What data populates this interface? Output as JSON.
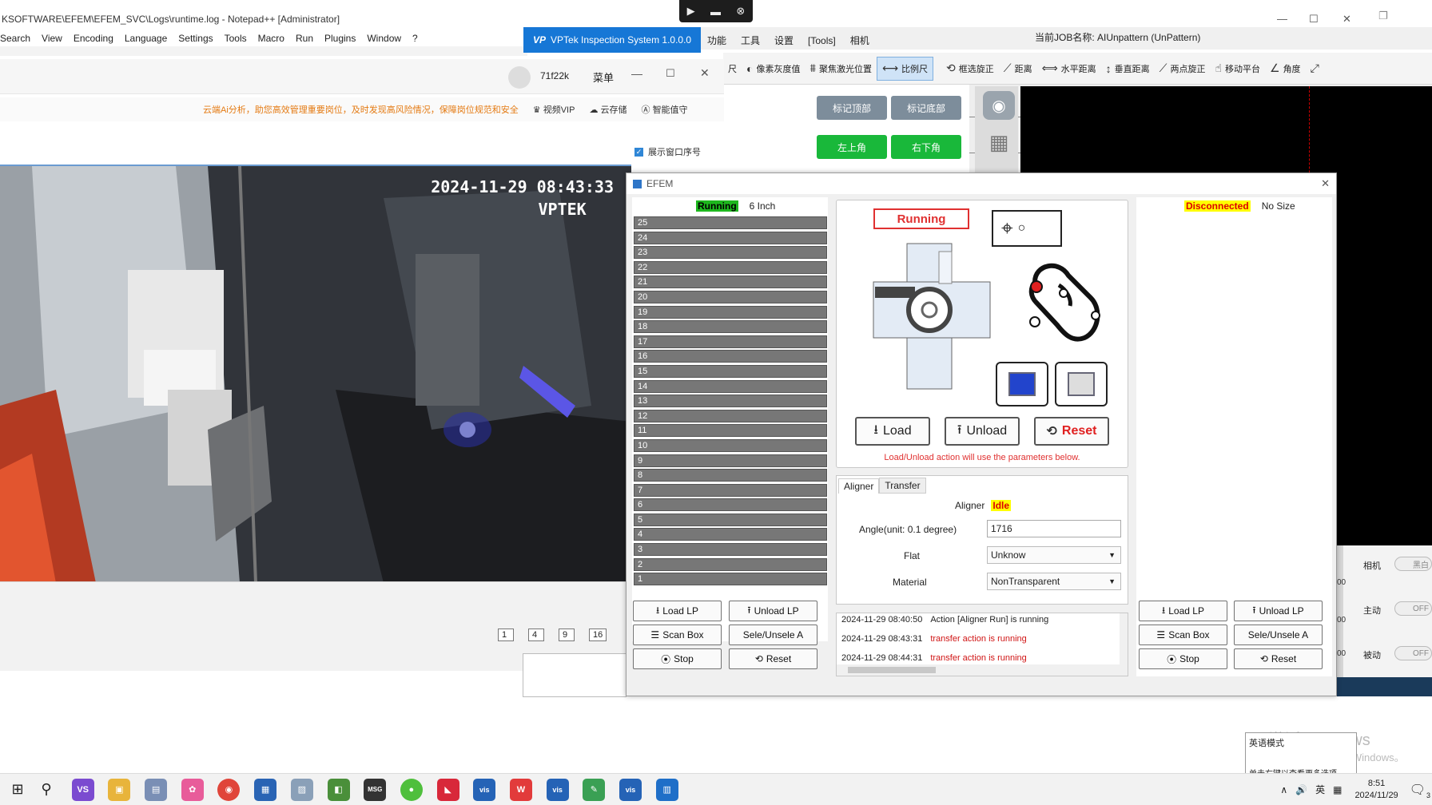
{
  "notepad": {
    "title": "KSOFTWARE\\EFEM\\EFEM_SVC\\Logs\\runtime.log - Notepad++ [Administrator]",
    "menu": [
      "Search",
      "View",
      "Encoding",
      "Language",
      "Settings",
      "Tools",
      "Macro",
      "Run",
      "Plugins",
      "Window",
      "?"
    ]
  },
  "vptek": {
    "app_title": "VPTek Inspection System 1.0.0.0",
    "menu": [
      "功能",
      "工具",
      "设置",
      "[Tools]",
      "相机"
    ],
    "job_label": "当前JOB名称: AIUnpattern (UnPattern)",
    "toolbar": [
      {
        "label": "尺",
        "icon": "ruler-icon"
      },
      {
        "label": "像素灰度值",
        "icon": "grayscale-icon"
      },
      {
        "label": "聚焦激光位置",
        "icon": "laser-focus-icon"
      },
      {
        "label": "比例尺",
        "icon": "scale-bar-icon",
        "active": true
      },
      {
        "label": "框选旋正",
        "icon": "box-rotate-icon"
      },
      {
        "label": "距离",
        "icon": "distance-icon"
      },
      {
        "label": "水平距离",
        "icon": "horizontal-distance-icon"
      },
      {
        "label": "垂直距离",
        "icon": "vertical-distance-icon"
      },
      {
        "label": "两点旋正",
        "icon": "two-point-rotate-icon"
      },
      {
        "label": "移动平台",
        "icon": "move-stage-icon"
      },
      {
        "label": "角度",
        "icon": "angle-icon"
      }
    ],
    "mark_top": "标记顶部",
    "mark_bottom": "标记底部",
    "top_left": "左上角",
    "bottom_right": "右下角",
    "right_labels": [
      {
        "label": "相机",
        "toggle": "黑白"
      },
      {
        "label": "主动",
        "toggle": "OFF"
      },
      {
        "label": "被动",
        "toggle": "OFF"
      }
    ],
    "side_values": [
      "00",
      "00",
      "00"
    ]
  },
  "video_window": {
    "user": "71f22k",
    "menu_label": "菜单",
    "tip": "云端Ai分析，助您高效管理重要岗位，及时发现高风险情况，保障岗位规范和安全",
    "tools": [
      "视频VIP",
      "云存储",
      "智能值守"
    ],
    "show_index_label": "展示窗口序号",
    "timestamp": "2024-11-29 08:43:33",
    "watermark": "VPTEK",
    "layouts": [
      "1",
      "4",
      "9",
      "16"
    ]
  },
  "efem": {
    "title": "EFEM",
    "left_port": {
      "status": "Running",
      "size": "6 Inch",
      "slots": [
        "25",
        "24",
        "23",
        "22",
        "21",
        "20",
        "19",
        "18",
        "17",
        "16",
        "15",
        "14",
        "13",
        "12",
        "11",
        "10",
        "9",
        "8",
        "7",
        "6",
        "5",
        "4",
        "3",
        "2",
        "1"
      ],
      "buttons": {
        "load_lp": "Load LP",
        "unload_lp": "Unload LP",
        "scan_box": "Scan Box",
        "sele": "Sele/Unsele A",
        "stop": "Stop",
        "reset": "Reset"
      }
    },
    "center": {
      "status": "Running",
      "load": "Load",
      "unload": "Unload",
      "reset": "Reset",
      "note": "Load/Unload action will use the parameters below.",
      "tabs": [
        "Aligner",
        "Transfer"
      ],
      "aligner_label": "Aligner",
      "aligner_status": "Idle",
      "angle_label": "Angle(unit:  0.1 degree)",
      "angle_value": "1716",
      "flat_label": "Flat",
      "flat_value": "Unknow",
      "material_label": "Material",
      "material_value": "NonTransparent",
      "log": [
        {
          "time": "2024-11-29 08:40:50",
          "msg": "Action [Aligner Run] is running",
          "color": "#222222"
        },
        {
          "time": "2024-11-29 08:43:31",
          "msg": "transfer action is running",
          "color": "#d01515"
        },
        {
          "time": "2024-11-29 08:44:31",
          "msg": "transfer action is running",
          "color": "#d01515"
        }
      ]
    },
    "right_port": {
      "status": "Disconnected",
      "size": "No Size",
      "buttons": {
        "load_lp": "Load LP",
        "unload_lp": "Unload LP",
        "scan_box": "Scan Box",
        "sele": "Sele/Unsele A",
        "stop": "Stop",
        "reset": "Reset"
      }
    }
  },
  "activation": {
    "line1": "激活 Windows",
    "line2": "转到\"设置\"以激活 Windows。",
    "ime_title": "英语模式",
    "ime_hint": "单击右键以查看更多选项"
  },
  "taskbar": {
    "time": "8:51",
    "date": "2024/11/29",
    "ime": "英",
    "notification_count": "3",
    "colors": {
      "accent": "#1677d6",
      "running": "#1eb81e",
      "disconnected": "#ffff00",
      "alert": "#d01515"
    }
  }
}
